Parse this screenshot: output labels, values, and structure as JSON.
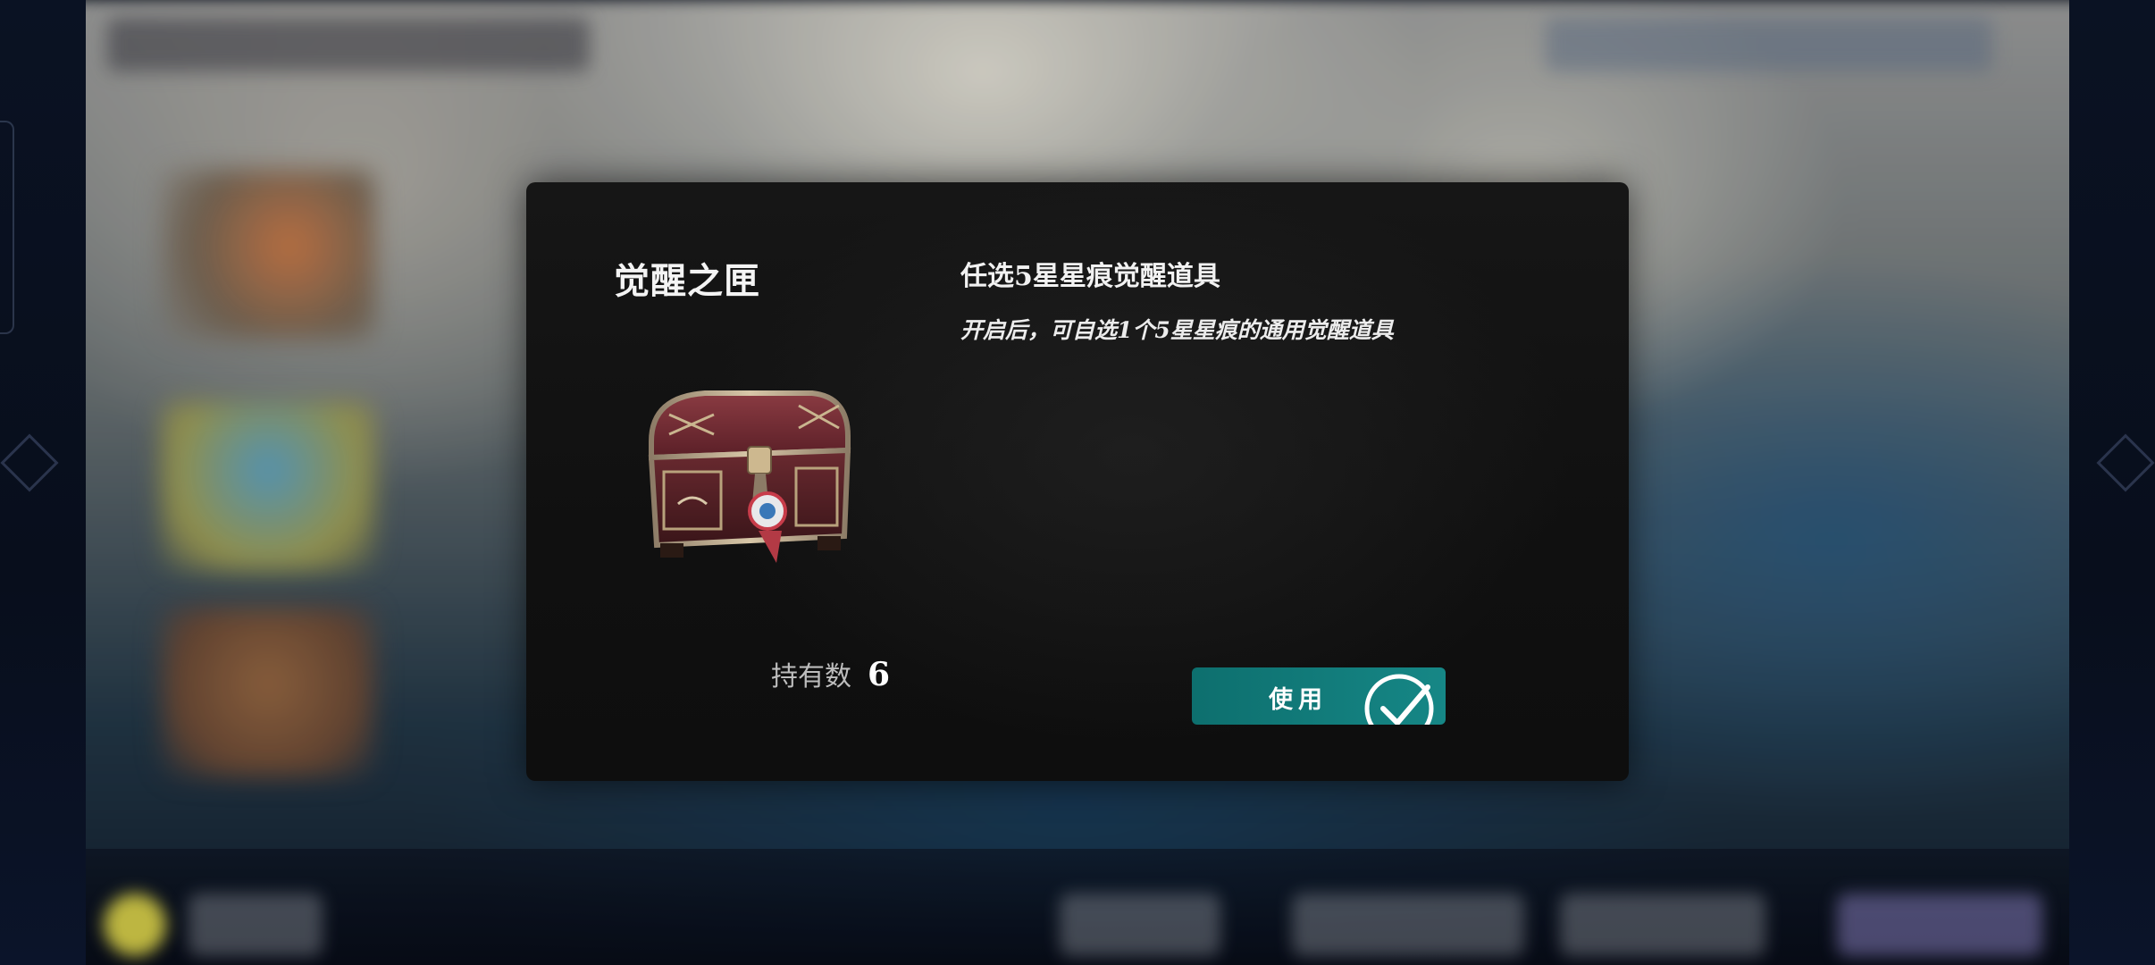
{
  "dialog": {
    "item_name": "觉醒之匣",
    "item_icon": "treasure-chest-icon",
    "owned_label": "持有数",
    "owned_count": "6",
    "description_title": "任选5星星痕觉醒道具",
    "description_text": "开启后，可自选1个5星星痕的通用觉醒道具",
    "use_button_label": "使用",
    "use_button_icon": "checkmark-circle-icon"
  },
  "colors": {
    "dialog_bg": "#121212",
    "button_teal": "#128080",
    "text_primary": "#f4f4f4",
    "text_secondary": "#bdbdbd"
  }
}
